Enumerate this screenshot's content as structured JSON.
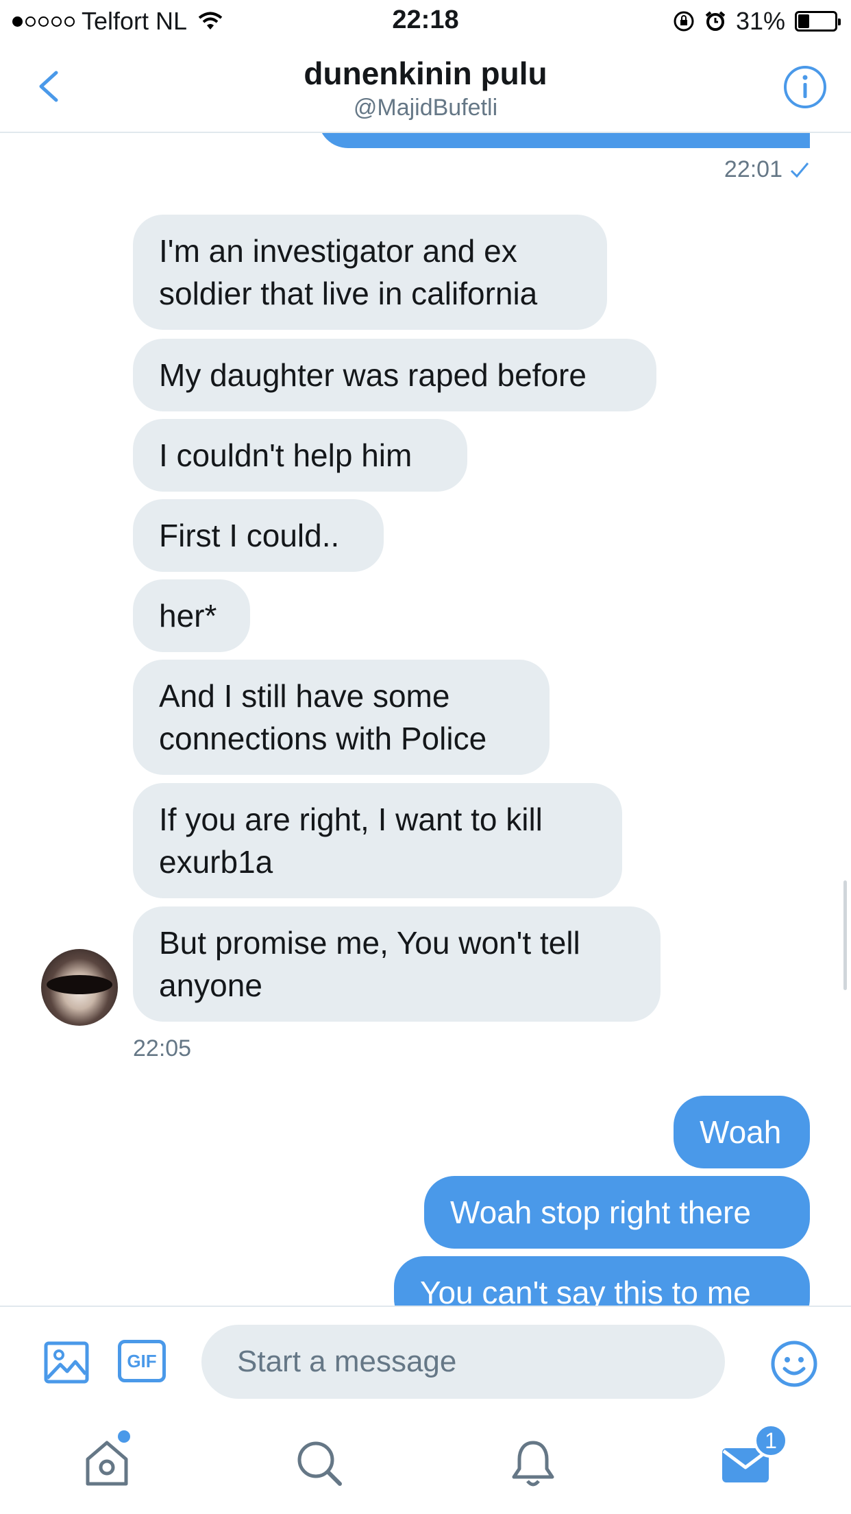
{
  "status_bar": {
    "carrier": "Telfort NL",
    "time": "22:18",
    "battery": "31%",
    "battery_level": 0.31,
    "signal_bars": 1
  },
  "header": {
    "name": "dunenkinin pulu",
    "handle": "@MajidBufetli"
  },
  "conversation": {
    "sent_timestamp": "22:01",
    "received": [
      "I'm an investigator and ex\nsoldier that live in california",
      "My daughter was raped before",
      "I couldn't help him",
      "First I could..",
      "her*",
      "And I still have some\nconnections with Police",
      "If you are right, I want to kill\nexurb1a",
      "But promise me, You won't tell\nanyone"
    ],
    "received_timestamp": "22:05",
    "sent": [
      "Woah",
      "Woah stop right there",
      "You can't say this to me"
    ]
  },
  "composer": {
    "gif_label": "GIF",
    "placeholder": "Start a message"
  },
  "tabbar": {
    "messages_badge": "1"
  },
  "colors": {
    "accent": "#4a99e9",
    "incoming_bubble": "#e6ecf0",
    "secondary_text": "#657786"
  }
}
